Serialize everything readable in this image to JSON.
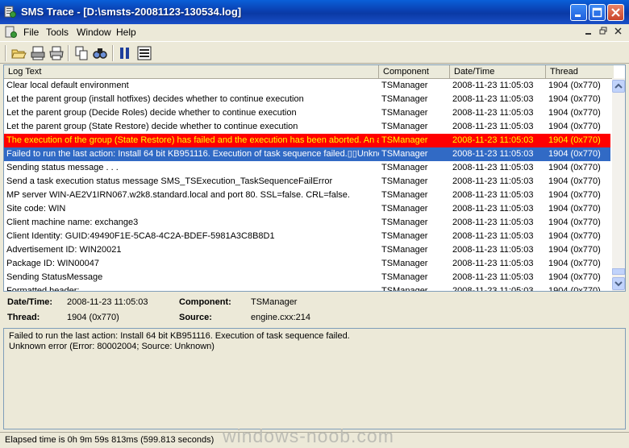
{
  "window": {
    "title": "SMS Trace - [D:\\smsts-20081123-130534.log]"
  },
  "menu": {
    "file": "File",
    "tools": "Tools",
    "window": "Window",
    "help": "Help"
  },
  "columns": {
    "log_text": "Log Text",
    "component": "Component",
    "datetime": "Date/Time",
    "thread": "Thread"
  },
  "rows": [
    {
      "text": "Clear local default environment",
      "component": "TSManager",
      "datetime": "2008-11-23 11:05:03",
      "thread": "1904 (0x770)"
    },
    {
      "text": "Let the parent group (install hotfixes) decides whether to continue execution",
      "component": "TSManager",
      "datetime": "2008-11-23 11:05:03",
      "thread": "1904 (0x770)"
    },
    {
      "text": "Let the parent group (Decide Roles) decide whether to continue execution",
      "component": "TSManager",
      "datetime": "2008-11-23 11:05:03",
      "thread": "1904 (0x770)"
    },
    {
      "text": "Let the parent group (State Restore) decide whether to continue execution",
      "component": "TSManager",
      "datetime": "2008-11-23 11:05:03",
      "thread": "1904 (0x770)"
    },
    {
      "text": "The execution of the group (State Restore) has failed and the execution has been aborted. An ac",
      "component": "TSManager",
      "datetime": "2008-11-23 11:05:03",
      "thread": "1904 (0x770)"
    },
    {
      "text": "Failed to run the last action: Install 64 bit KB951116. Execution of task sequence failed.▯▯Unknow",
      "component": "TSManager",
      "datetime": "2008-11-23 11:05:03",
      "thread": "1904 (0x770)"
    },
    {
      "text": "Sending status message . . .",
      "component": "TSManager",
      "datetime": "2008-11-23 11:05:03",
      "thread": "1904 (0x770)"
    },
    {
      "text": "Send a task execution status message SMS_TSExecution_TaskSequenceFailError",
      "component": "TSManager",
      "datetime": "2008-11-23 11:05:03",
      "thread": "1904 (0x770)"
    },
    {
      "text": "MP server WIN-AE2V1IRN067.w2k8.standard.local and port 80. SSL=false. CRL=false.",
      "component": "TSManager",
      "datetime": "2008-11-23 11:05:03",
      "thread": "1904 (0x770)"
    },
    {
      "text": "Site code: WIN",
      "component": "TSManager",
      "datetime": "2008-11-23 11:05:03",
      "thread": "1904 (0x770)"
    },
    {
      "text": "Client machine name: exchange3",
      "component": "TSManager",
      "datetime": "2008-11-23 11:05:03",
      "thread": "1904 (0x770)"
    },
    {
      "text": "Client Identity: GUID:49490F1E-5CA8-4C2A-BDEF-5981A3C8B8D1",
      "component": "TSManager",
      "datetime": "2008-11-23 11:05:03",
      "thread": "1904 (0x770)"
    },
    {
      "text": "Advertisement ID: WIN20021",
      "component": "TSManager",
      "datetime": "2008-11-23 11:05:03",
      "thread": "1904 (0x770)"
    },
    {
      "text": "Package ID: WIN00047",
      "component": "TSManager",
      "datetime": "2008-11-23 11:05:03",
      "thread": "1904 (0x770)"
    },
    {
      "text": "Sending StatusMessage",
      "component": "TSManager",
      "datetime": "2008-11-23 11:05:03",
      "thread": "1904 (0x770)"
    },
    {
      "text": "Formatted header:",
      "component": "TSManager",
      "datetime": "2008-11-23 11:05:03",
      "thread": "1904 (0x770)"
    }
  ],
  "details": {
    "datetime_label": "Date/Time:",
    "datetime_value": "2008-11-23 11:05:03",
    "component_label": "Component:",
    "component_value": "TSManager",
    "thread_label": "Thread:",
    "thread_value": "1904 (0x770)",
    "source_label": "Source:",
    "source_value": "engine.cxx:214"
  },
  "message": {
    "line1": "Failed to run the last action: Install 64 bit KB951116. Execution of task sequence failed.",
    "line2": "Unknown error (Error: 80002004; Source: Unknown)"
  },
  "status": {
    "elapsed": "Elapsed time is 0h 9m 59s 813ms (599.813 seconds)"
  },
  "watermark": "windows-noob.com",
  "icons": [
    "app-icon",
    "open-icon",
    "print-setup-icon",
    "print-icon",
    "copy-icon",
    "find-icon",
    "pause-icon",
    "highlight-icon",
    "minimize-icon",
    "maximize-icon",
    "close-icon"
  ]
}
